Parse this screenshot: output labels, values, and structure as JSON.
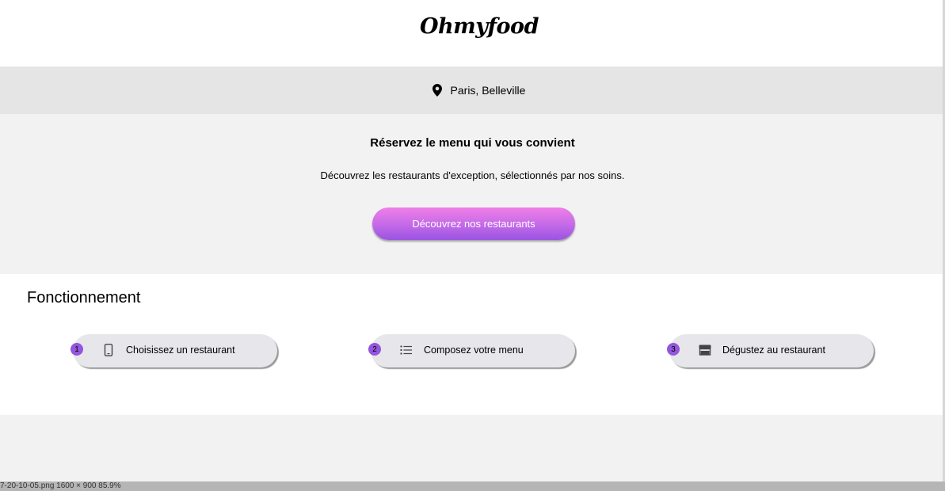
{
  "header": {
    "logo": "Ohmyfood"
  },
  "location": {
    "icon": "map-pin-icon",
    "text": "Paris, Belleville"
  },
  "hero": {
    "title": "Réservez le menu qui vous convient",
    "subtitle": "Découvrez les restaurants d'exception, sélectionnés par nos soins.",
    "cta_label": "Découvrez nos restaurants"
  },
  "steps": {
    "title": "Fonctionnement",
    "items": [
      {
        "num": "1",
        "icon": "mobile-phone-icon",
        "label": "Choisissez un restaurant"
      },
      {
        "num": "2",
        "icon": "list-icon",
        "label": "Composez votre menu"
      },
      {
        "num": "3",
        "icon": "store-icon",
        "label": "Dégustez au restaurant"
      }
    ]
  },
  "statusbar": {
    "text": "7-20-10-05.png  1600 × 900   85.9%"
  },
  "colors": {
    "accent_start": "#f07fe6",
    "accent_end": "#9a54e2",
    "step_badge": "#9356dc",
    "step_bg": "#e7e6eb"
  }
}
